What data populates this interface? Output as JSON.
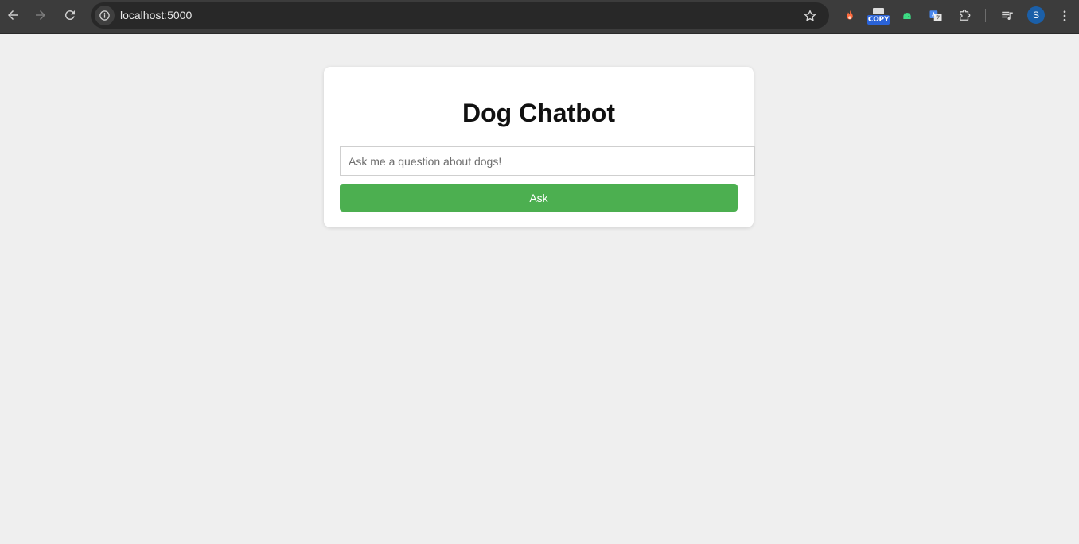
{
  "browser": {
    "url": "localhost:5000",
    "extensions": [
      {
        "name": "fire-extension-icon"
      },
      {
        "name": "copy-extension-icon",
        "label": "COPY"
      },
      {
        "name": "android-extension-icon"
      },
      {
        "name": "translate-extension-icon"
      },
      {
        "name": "puzzle-icon"
      }
    ],
    "profile_initial": "S",
    "colors": {
      "toolbar": "#3c3c3c",
      "omnibox": "#282828",
      "profile": "#1b5fa8"
    }
  },
  "page": {
    "title": "Dog Chatbot",
    "input_placeholder": "Ask me a question about dogs!",
    "input_value": "",
    "ask_label": "Ask",
    "colors": {
      "background": "#efefef",
      "card": "#ffffff",
      "button": "#4caf50"
    }
  }
}
